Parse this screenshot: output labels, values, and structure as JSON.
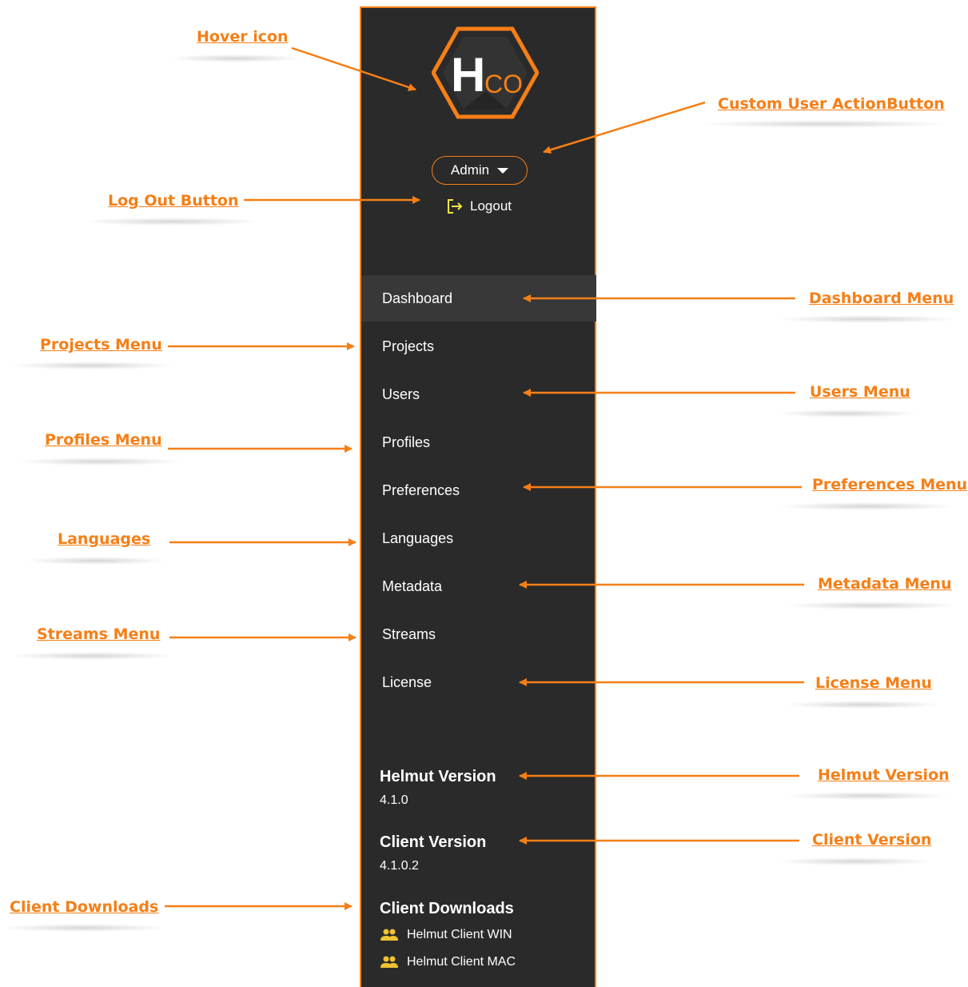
{
  "sidebar": {
    "logo_text": "HCO",
    "admin_label": "Admin",
    "logout_label": "Logout",
    "menu": [
      {
        "label": "Dashboard",
        "active": true
      },
      {
        "label": "Projects"
      },
      {
        "label": "Users"
      },
      {
        "label": "Profiles"
      },
      {
        "label": "Preferences"
      },
      {
        "label": "Languages"
      },
      {
        "label": "Metadata"
      },
      {
        "label": "Streams"
      },
      {
        "label": "License"
      }
    ],
    "helmut_version_title": "Helmut Version",
    "helmut_version": "4.1.0",
    "client_version_title": "Client Version",
    "client_version": "4.1.0.2",
    "downloads_title": "Client Downloads",
    "downloads": [
      {
        "label": "Helmut Client WIN",
        "icon": "users-icon"
      },
      {
        "label": "Helmut Client MAC",
        "icon": "users-icon"
      }
    ]
  },
  "annotations": {
    "hover_icon": "Hover icon",
    "custom_user_action": "Custom User ActionButton",
    "log_out_button": "Log Out Button",
    "dashboard_menu": "Dashboard Menu",
    "projects_menu": "Projects Menu",
    "users_menu": "Users Menu",
    "profiles_menu": "Profiles Menu",
    "preferences_menu": "Preferences Menu",
    "languages": "Languages",
    "metadata_menu": "Metadata Menu",
    "streams_menu": "Streams Menu",
    "license_menu": "License Menu",
    "helmut_version": "Helmut Version",
    "client_version": "Client Version",
    "client_downloads": "Client Downloads"
  },
  "colors": {
    "accent": "#f57f17",
    "sidebar_bg": "#2a2a2a",
    "active_bg": "#383838",
    "logout_icon": "#f1e64a",
    "download_icon": "#f1c232"
  }
}
